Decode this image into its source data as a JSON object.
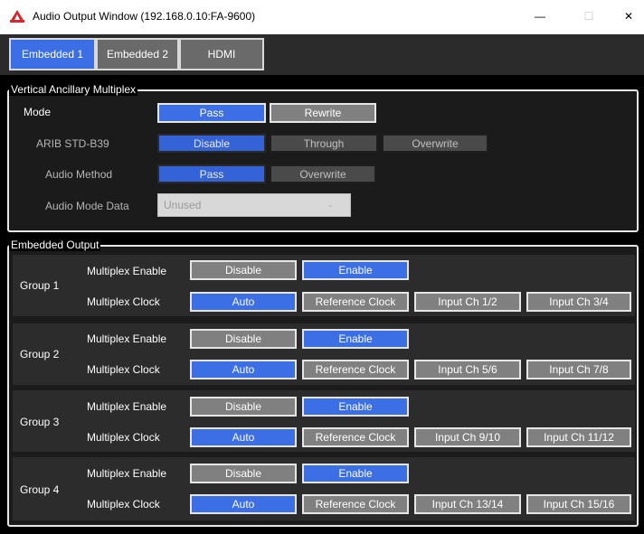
{
  "window": {
    "title": "Audio Output Window (192.168.0.10:FA-9600)",
    "controls": {
      "minimize": "—",
      "maximize": "☐",
      "close": "✕"
    }
  },
  "tabs": [
    {
      "label": "Embedded 1",
      "active": true
    },
    {
      "label": "Embedded 2",
      "active": false
    },
    {
      "label": "HDMI",
      "active": false
    }
  ],
  "vam": {
    "legend": "Vertical Ancillary Multiplex",
    "mode": {
      "label": "Mode",
      "options": [
        "Pass",
        "Rewrite"
      ],
      "selected": "Pass"
    },
    "arib": {
      "label": "ARIB STD-B39",
      "options": [
        "Disable",
        "Through",
        "Overwrite"
      ],
      "selected": "Disable"
    },
    "audio_method": {
      "label": "Audio Method",
      "options": [
        "Pass",
        "Overwrite"
      ],
      "selected": "Pass"
    },
    "audio_mode_data": {
      "label": "Audio Mode Data",
      "value": "Unused",
      "chevron": "⌄"
    }
  },
  "embedded_output": {
    "legend": "Embedded Output",
    "mux_enable_label": "Multiplex Enable",
    "mux_clock_label": "Multiplex Clock",
    "groups": [
      {
        "name": "Group 1",
        "enable": [
          "Disable",
          "Enable"
        ],
        "enable_selected": "Enable",
        "clock": [
          "Auto",
          "Reference Clock",
          "Input Ch 1/2",
          "Input Ch 3/4"
        ],
        "clock_selected": "Auto"
      },
      {
        "name": "Group 2",
        "enable": [
          "Disable",
          "Enable"
        ],
        "enable_selected": "Enable",
        "clock": [
          "Auto",
          "Reference Clock",
          "Input Ch 5/6",
          "Input Ch 7/8"
        ],
        "clock_selected": "Auto"
      },
      {
        "name": "Group 3",
        "enable": [
          "Disable",
          "Enable"
        ],
        "enable_selected": "Enable",
        "clock": [
          "Auto",
          "Reference Clock",
          "Input Ch 9/10",
          "Input Ch 11/12"
        ],
        "clock_selected": "Auto"
      },
      {
        "name": "Group 4",
        "enable": [
          "Disable",
          "Enable"
        ],
        "enable_selected": "Enable",
        "clock": [
          "Auto",
          "Reference Clock",
          "Input Ch 13/14",
          "Input Ch 15/16"
        ],
        "clock_selected": "Auto"
      }
    ]
  },
  "colors": {
    "accent": "#3c6ee6",
    "inactive_button": "#808080",
    "background": "#000000",
    "panel": "#1b1b1b",
    "app_icon": "#d9262b"
  }
}
